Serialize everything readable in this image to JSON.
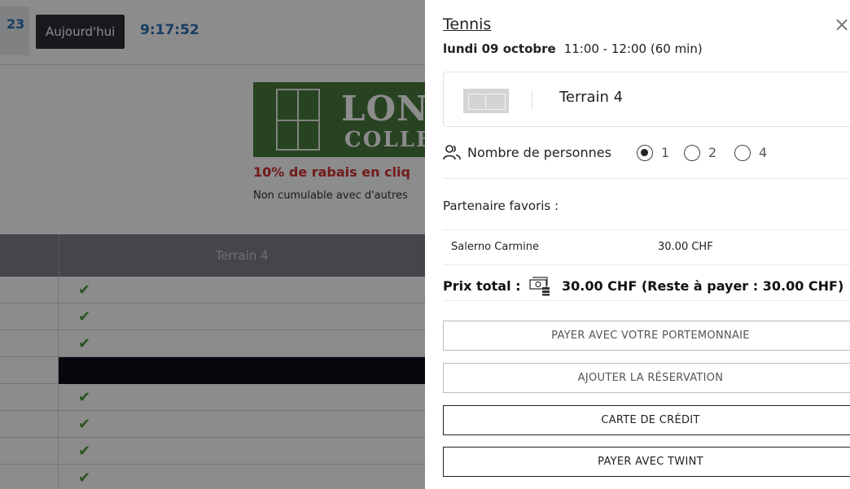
{
  "background": {
    "date_fragment": "23",
    "today_button": "Aujourd'hui",
    "clock": "9:17:52",
    "banner": {
      "line1": "LOND",
      "line2": "COLLEC"
    },
    "promo": "10% de rabais en cliq",
    "promo_sub": "Non cumulable avec d'autres",
    "column_header": "Terrain 4",
    "rows": [
      {
        "status": "available"
      },
      {
        "status": "available"
      },
      {
        "status": "available"
      },
      {
        "status": "blocked"
      },
      {
        "status": "available"
      },
      {
        "status": "available"
      },
      {
        "status": "available"
      },
      {
        "status": "available"
      }
    ],
    "check_glyph": "✔"
  },
  "panel": {
    "title": "Tennis",
    "close_icon": "×",
    "date": "lundi 09 octobre",
    "time": "11:00 - 12:00 (60 min)",
    "court": "Terrain 4",
    "persons_label": "Nombre de personnes",
    "persons_options": [
      "1",
      "2",
      "4"
    ],
    "persons_selected": "1",
    "favorites_label": "Partenaire favoris :",
    "favorite": {
      "name": "Salerno Carmine",
      "price": "30.00 CHF"
    },
    "total_label": "Prix total :",
    "total_value": "30.00 CHF (Reste à payer : 30.00 CHF)",
    "buttons": {
      "wallet": "PAYER AVEC VOTRE PORTEMONNAIE",
      "add": "AJOUTER LA RÉSERVATION",
      "card": "CARTE DE CRÉDIT",
      "twint": "PAYER AVEC TWINT"
    }
  },
  "colors": {
    "accent_blue": "#2a6db0",
    "check_green": "#4a9a3a",
    "promo_red": "#d03030"
  }
}
